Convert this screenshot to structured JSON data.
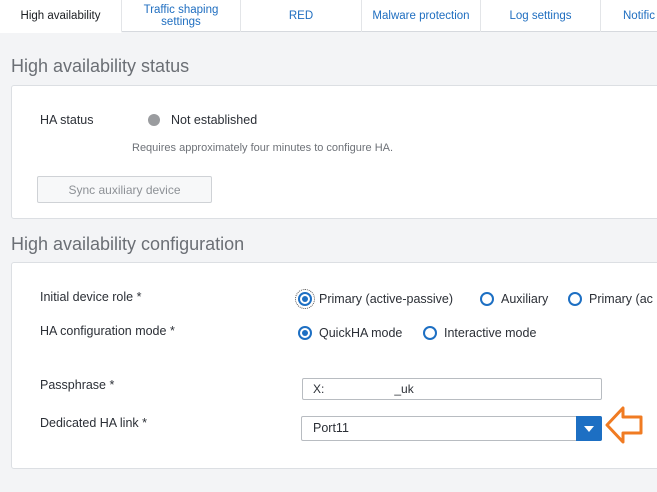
{
  "tabs": [
    {
      "label": "High availability"
    },
    {
      "label": "Traffic shaping\nsettings"
    },
    {
      "label": "RED"
    },
    {
      "label": "Malware protection"
    },
    {
      "label": "Log settings"
    },
    {
      "label": "Notific"
    }
  ],
  "status_section": {
    "title": "High availability status",
    "ha_status_label": "HA status",
    "ha_status_value": "Not established",
    "hint": "Requires approximately four minutes to configure HA.",
    "sync_button": "Sync auxiliary device"
  },
  "config_section": {
    "title": "High availability configuration",
    "device_role": {
      "label": "Initial device role *",
      "options": [
        "Primary (active-passive)",
        "Auxiliary",
        "Primary (ac"
      ],
      "selected": 0
    },
    "config_mode": {
      "label": "HA configuration mode *",
      "options": [
        "QuickHA mode",
        "Interactive mode"
      ],
      "selected": 0
    },
    "passphrase": {
      "label": "Passphrase *",
      "value": "X:                     _uk"
    },
    "ha_link": {
      "label": "Dedicated HA link *",
      "value": "Port11"
    }
  },
  "colors": {
    "accent": "#1d6fc3",
    "annotation": "#f07b22",
    "status_inactive": "#9a9c9f"
  }
}
